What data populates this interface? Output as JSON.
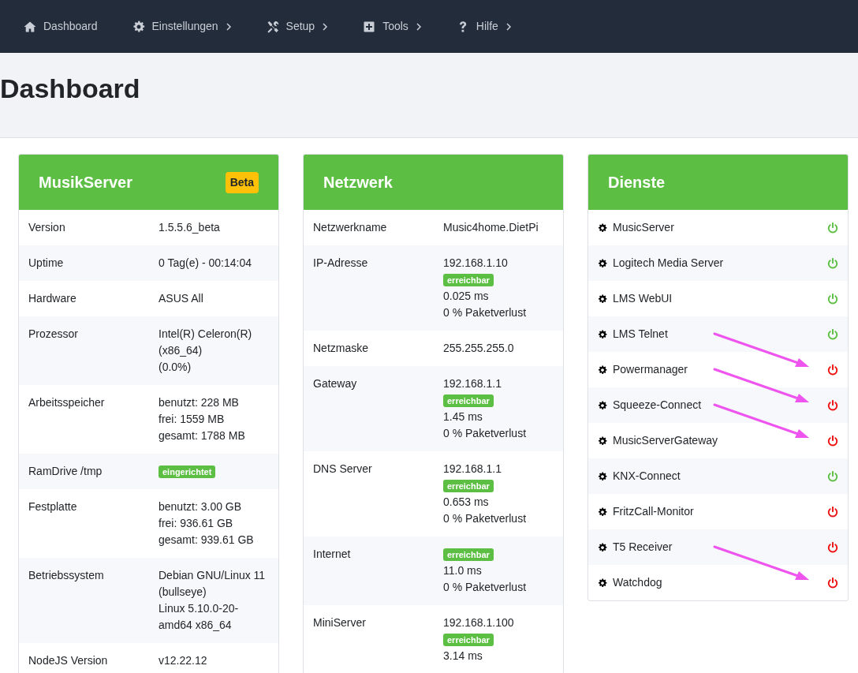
{
  "navbar": {
    "items": [
      {
        "label": "Dashboard",
        "has_submenu": false
      },
      {
        "label": "Einstellungen",
        "has_submenu": true
      },
      {
        "label": "Setup",
        "has_submenu": true
      },
      {
        "label": "Tools",
        "has_submenu": true
      },
      {
        "label": "Hilfe",
        "has_submenu": true
      }
    ]
  },
  "page_title": "Dashboard",
  "cards": [
    {
      "title": "MusikServer",
      "badge": "Beta",
      "rows": [
        {
          "label": "Version",
          "lines": [
            {
              "kind": "text",
              "text": "1.5.5.6_beta"
            }
          ]
        },
        {
          "label": "Uptime",
          "lines": [
            {
              "kind": "text",
              "text": "0 Tag(e) - 00:14:04"
            }
          ]
        },
        {
          "label": "Hardware",
          "lines": [
            {
              "kind": "text",
              "text": "ASUS All"
            }
          ]
        },
        {
          "label": "Prozessor",
          "lines": [
            {
              "kind": "text",
              "text": "Intel(R) Celeron(R) (x86_64)"
            },
            {
              "kind": "text",
              "text": "(0.0%)"
            }
          ]
        },
        {
          "label": "Arbeitsspeicher",
          "lines": [
            {
              "kind": "text",
              "text": "benutzt: 228 MB"
            },
            {
              "kind": "text",
              "text": "frei: 1559 MB"
            },
            {
              "kind": "text",
              "text": "gesamt: 1788 MB"
            }
          ]
        },
        {
          "label": "RamDrive /tmp",
          "lines": [
            {
              "kind": "badge",
              "text": "eingerichtet"
            }
          ]
        },
        {
          "label": "Festplatte",
          "lines": [
            {
              "kind": "text",
              "text": "benutzt: 3.00 GB"
            },
            {
              "kind": "text",
              "text": "frei: 936.61 GB"
            },
            {
              "kind": "text",
              "text": "gesamt: 939.61 GB"
            }
          ]
        },
        {
          "label": "Betriebssystem",
          "lines": [
            {
              "kind": "text",
              "text": "Debian GNU/Linux 11 (bullseye)"
            },
            {
              "kind": "text",
              "text": "Linux 5.10.0-20-amd64 x86_64"
            }
          ]
        },
        {
          "label": "NodeJS Version",
          "lines": [
            {
              "kind": "text",
              "text": "v12.22.12"
            }
          ]
        }
      ]
    },
    {
      "title": "Netzwerk",
      "rows": [
        {
          "label": "Netzwerkname",
          "lines": [
            {
              "kind": "text",
              "text": "Music4home.DietPi"
            }
          ]
        },
        {
          "label": "IP-Adresse",
          "lines": [
            {
              "kind": "text",
              "text": "192.168.1.10"
            },
            {
              "kind": "badge",
              "text": "erreichbar"
            },
            {
              "kind": "text",
              "text": "0.025 ms"
            },
            {
              "kind": "text",
              "text": "0 % Paketverlust"
            }
          ]
        },
        {
          "label": "Netzmaske",
          "lines": [
            {
              "kind": "text",
              "text": "255.255.255.0"
            }
          ]
        },
        {
          "label": "Gateway",
          "lines": [
            {
              "kind": "text",
              "text": "192.168.1.1"
            },
            {
              "kind": "badge",
              "text": "erreichbar"
            },
            {
              "kind": "text",
              "text": "1.45 ms"
            },
            {
              "kind": "text",
              "text": "0 % Paketverlust"
            }
          ]
        },
        {
          "label": "DNS Server",
          "lines": [
            {
              "kind": "text",
              "text": "192.168.1.1"
            },
            {
              "kind": "badge",
              "text": "erreichbar"
            },
            {
              "kind": "text",
              "text": "0.653 ms"
            },
            {
              "kind": "text",
              "text": "0 % Paketverlust"
            }
          ]
        },
        {
          "label": "Internet",
          "lines": [
            {
              "kind": "badge",
              "text": "erreichbar"
            },
            {
              "kind": "text",
              "text": "11.0 ms"
            },
            {
              "kind": "text",
              "text": "0 % Paketverlust"
            }
          ]
        },
        {
          "label": "MiniServer",
          "lines": [
            {
              "kind": "text",
              "text": "192.168.1.100"
            },
            {
              "kind": "badge",
              "text": "erreichbar"
            },
            {
              "kind": "text",
              "text": "3.14 ms"
            }
          ]
        }
      ]
    }
  ],
  "services": {
    "title": "Dienste",
    "items": [
      {
        "name": "MusicServer",
        "on": true,
        "arrow": false
      },
      {
        "name": "Logitech Media Server",
        "on": true,
        "arrow": false
      },
      {
        "name": "LMS WebUI",
        "on": true,
        "arrow": false
      },
      {
        "name": "LMS Telnet",
        "on": true,
        "arrow": false
      },
      {
        "name": "Powermanager",
        "on": false,
        "arrow": true
      },
      {
        "name": "Squeeze-Connect",
        "on": false,
        "arrow": true
      },
      {
        "name": "MusicServerGateway",
        "on": false,
        "arrow": true
      },
      {
        "name": "KNX-Connect",
        "on": true,
        "arrow": false
      },
      {
        "name": "FritzCall-Monitor",
        "on": false,
        "arrow": false
      },
      {
        "name": "T5 Receiver",
        "on": false,
        "arrow": false
      },
      {
        "name": "Watchdog",
        "on": false,
        "arrow": true
      }
    ]
  }
}
